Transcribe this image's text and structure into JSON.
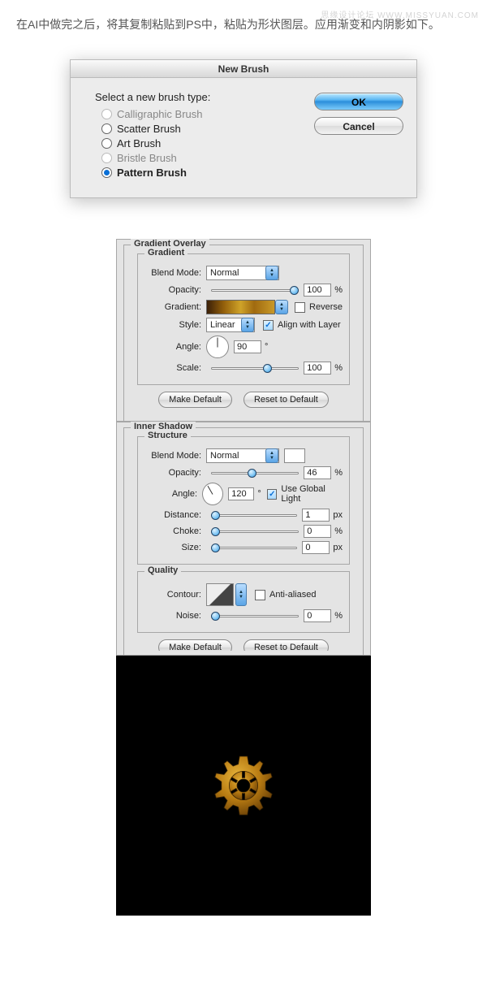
{
  "watermark": "思缘设计论坛 WWW.MISSYUAN.COM",
  "intro": "在AI中做完之后，将其复制粘贴到PS中，粘贴为形状图层。应用渐变和内阴影如下。",
  "newBrush": {
    "title": "New Brush",
    "prompt": "Select a new brush type:",
    "options": {
      "calligraphic": "Calligraphic Brush",
      "scatter": "Scatter Brush",
      "art": "Art Brush",
      "bristle": "Bristle Brush",
      "pattern": "Pattern Brush"
    },
    "ok": "OK",
    "cancel": "Cancel"
  },
  "gradientOverlay": {
    "title": "Gradient Overlay",
    "gradientSection": "Gradient",
    "blendModeLabel": "Blend Mode:",
    "blendMode": "Normal",
    "opacityLabel": "Opacity:",
    "opacity": "100",
    "opacityUnit": "%",
    "gradientLabel": "Gradient:",
    "reverse": "Reverse",
    "styleLabel": "Style:",
    "style": "Linear",
    "alignWithLayer": "Align with Layer",
    "angleLabel": "Angle:",
    "angle": "90",
    "angleUnit": "°",
    "scaleLabel": "Scale:",
    "scale": "100",
    "scaleUnit": "%",
    "makeDefault": "Make Default",
    "resetDefault": "Reset to Default"
  },
  "innerShadow": {
    "title": "Inner Shadow",
    "structure": "Structure",
    "blendModeLabel": "Blend Mode:",
    "blendMode": "Normal",
    "opacityLabel": "Opacity:",
    "opacity": "46",
    "opacityUnit": "%",
    "angleLabel": "Angle:",
    "angle": "120",
    "angleUnit": "°",
    "useGlobal": "Use Global Light",
    "distanceLabel": "Distance:",
    "distance": "1",
    "distanceUnit": "px",
    "chokeLabel": "Choke:",
    "choke": "0",
    "chokeUnit": "%",
    "sizeLabel": "Size:",
    "size": "0",
    "sizeUnit": "px",
    "quality": "Quality",
    "contourLabel": "Contour:",
    "antiAliased": "Anti-aliased",
    "noiseLabel": "Noise:",
    "noise": "0",
    "noiseUnit": "%",
    "makeDefault": "Make Default",
    "resetDefault": "Reset to Default"
  }
}
